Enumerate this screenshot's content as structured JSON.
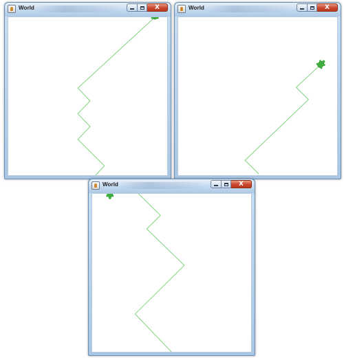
{
  "colors": {
    "path": "#7fd27f",
    "turtle": "#3fae3f",
    "turtle_dark": "#2f8f2f",
    "close": "#c8462c"
  },
  "windows": [
    {
      "title": "World",
      "close_label": "X",
      "turtle_heading_deg": 0
    },
    {
      "title": "World",
      "close_label": "X",
      "turtle_heading_deg": 45
    },
    {
      "title": "World",
      "close_label": "X",
      "turtle_heading_deg": 180
    }
  ]
}
